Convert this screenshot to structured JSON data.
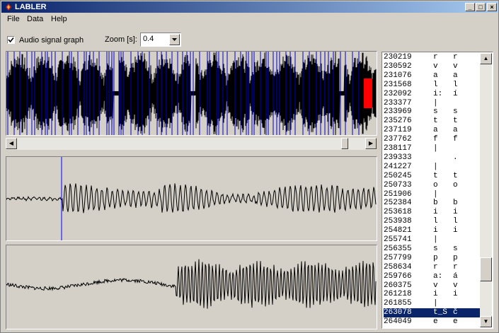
{
  "window": {
    "title": "LABLER"
  },
  "menu": [
    "File",
    "Data",
    "Help"
  ],
  "controls": {
    "audio_graph_label": "Audio signal graph",
    "audio_graph_checked": true,
    "zoom_label": "Zoom [s]:",
    "zoom_value": "0.4"
  },
  "title_buttons": {
    "minimize": "_",
    "maximize": "□",
    "close": "×"
  },
  "scroll_glyphs": {
    "left": "◀",
    "right": "▶",
    "up": "▲",
    "down": "▼"
  },
  "horizontal_scroll_position": 0.95,
  "vertical_scroll_position": 0.85,
  "cursor_position_fraction": 0.15,
  "colors": {
    "overview_label_lines": "#0000c0",
    "overview_current": "#ff0000",
    "cursor_line": "#0000ff",
    "selection": "#0a246a",
    "title_gradient_start": "#0a246a",
    "title_gradient_end": "#a6caf0"
  },
  "labels": [
    {
      "time": "230219",
      "phone": "r",
      "letter": "r"
    },
    {
      "time": "230592",
      "phone": "v",
      "letter": "v"
    },
    {
      "time": "231076",
      "phone": "a",
      "letter": "a"
    },
    {
      "time": "231568",
      "phone": "l",
      "letter": "l"
    },
    {
      "time": "232092",
      "phone": "i:",
      "letter": "í"
    },
    {
      "time": "233377",
      "phone": "|",
      "letter": ""
    },
    {
      "time": "233969",
      "phone": "s",
      "letter": "s"
    },
    {
      "time": "235276",
      "phone": "t",
      "letter": "t"
    },
    {
      "time": "237119",
      "phone": "a",
      "letter": "a"
    },
    {
      "time": "237762",
      "phone": "f",
      "letter": "f"
    },
    {
      "time": "238117",
      "phone": "|",
      "letter": ""
    },
    {
      "time": "239333",
      "phone": "",
      "letter": "."
    },
    {
      "time": "241227",
      "phone": "|",
      "letter": ""
    },
    {
      "time": "250245",
      "phone": "t",
      "letter": "t"
    },
    {
      "time": "250733",
      "phone": "o",
      "letter": "o"
    },
    {
      "time": "251906",
      "phone": "|",
      "letter": ""
    },
    {
      "time": "252384",
      "phone": "b",
      "letter": "b"
    },
    {
      "time": "253618",
      "phone": "i",
      "letter": "i"
    },
    {
      "time": "253938",
      "phone": "l",
      "letter": "l"
    },
    {
      "time": "254821",
      "phone": "i",
      "letter": "i"
    },
    {
      "time": "255741",
      "phone": "|",
      "letter": ""
    },
    {
      "time": "256355",
      "phone": "s",
      "letter": "s"
    },
    {
      "time": "257799",
      "phone": "p",
      "letter": "p"
    },
    {
      "time": "258634",
      "phone": "r",
      "letter": "r"
    },
    {
      "time": "259766",
      "phone": "a:",
      "letter": "á"
    },
    {
      "time": "260375",
      "phone": "v",
      "letter": "v"
    },
    {
      "time": "261218",
      "phone": "i",
      "letter": "i"
    },
    {
      "time": "261855",
      "phone": "|",
      "letter": ""
    },
    {
      "time": "263078",
      "phone": "t_S",
      "letter": "č",
      "selected": true
    },
    {
      "time": "264049",
      "phone": "e",
      "letter": "e"
    }
  ]
}
